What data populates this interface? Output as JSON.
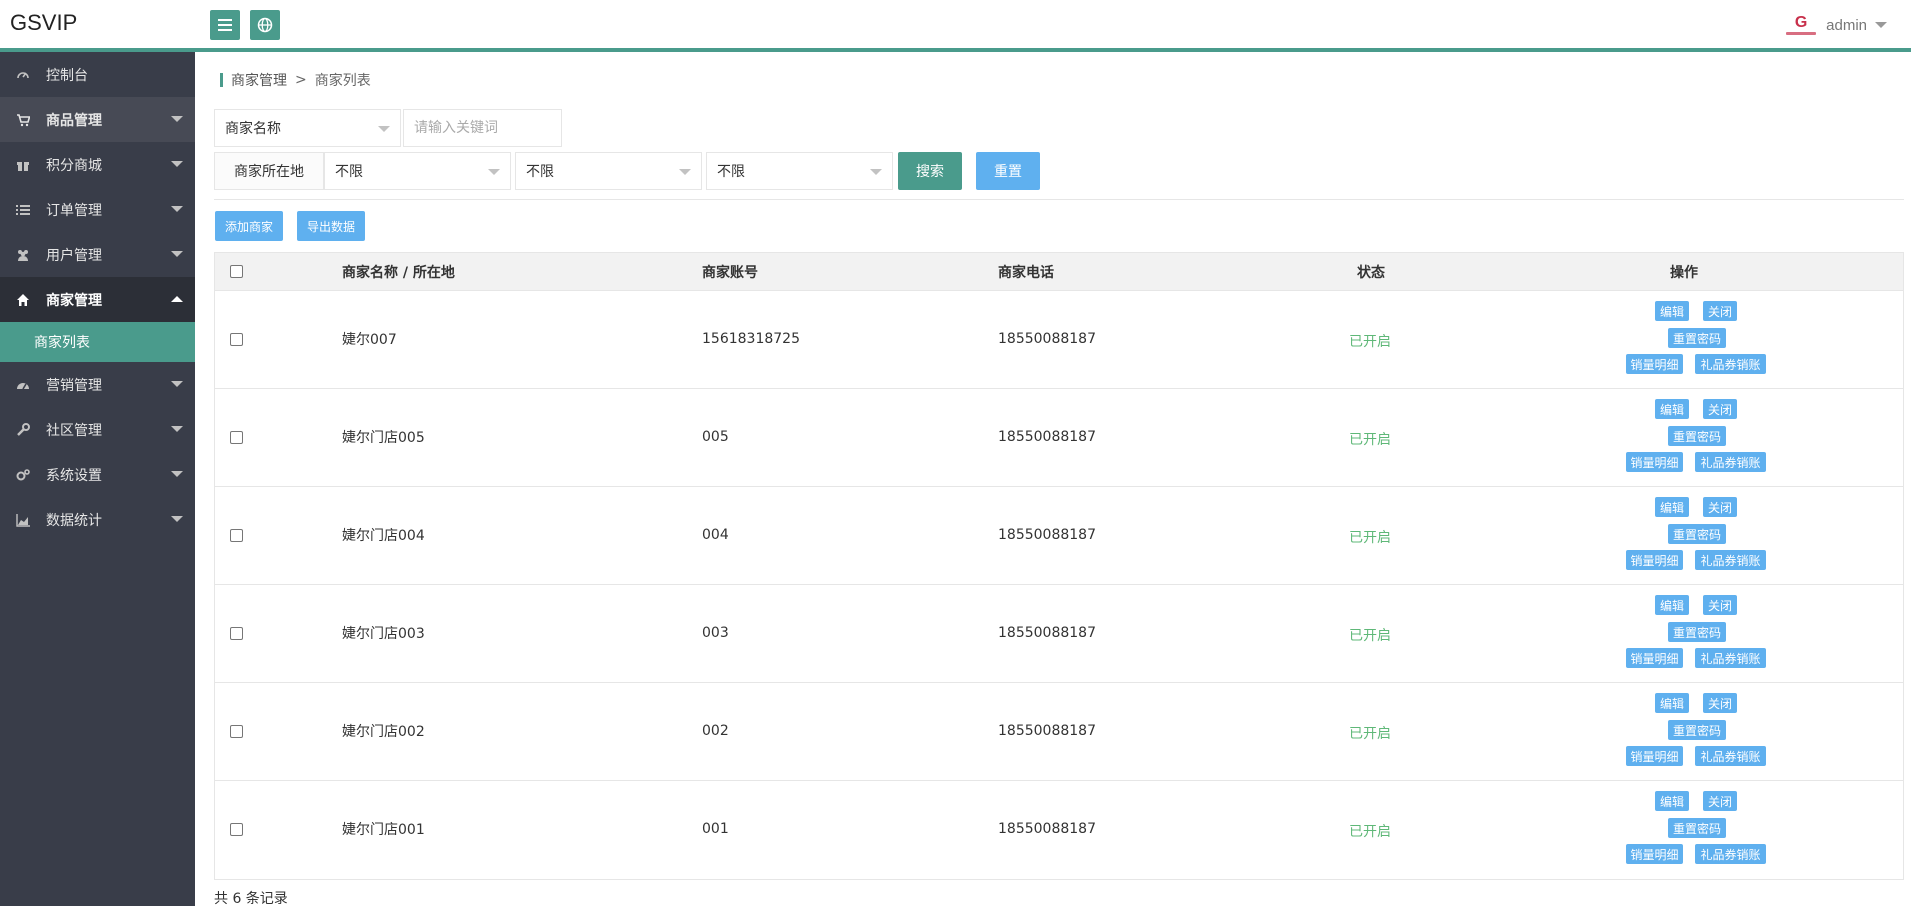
{
  "app": {
    "logo": "GSVIP",
    "user": "admin",
    "avatar_letter": "G"
  },
  "sidebar": {
    "items": [
      {
        "label": "控制台",
        "icon": "dashboard-icon"
      },
      {
        "label": "商品管理",
        "icon": "cart-icon"
      },
      {
        "label": "积分商城",
        "icon": "gift-icon"
      },
      {
        "label": "订单管理",
        "icon": "list-icon"
      },
      {
        "label": "用户管理",
        "icon": "users-icon"
      },
      {
        "label": "商家管理",
        "icon": "home-icon"
      },
      {
        "label": "营销管理",
        "icon": "gauge-icon"
      },
      {
        "label": "社区管理",
        "icon": "wrench-icon"
      },
      {
        "label": "系统设置",
        "icon": "gears-icon"
      },
      {
        "label": "数据统计",
        "icon": "area-chart-icon"
      }
    ],
    "sub_active": "商家列表"
  },
  "breadcrumb": {
    "parent": "商家管理",
    "sep": ">",
    "current": "商家列表"
  },
  "filters": {
    "field_select": "商家名称",
    "keyword_placeholder": "请输入关键词",
    "location_label": "商家所在地",
    "province": "不限",
    "city": "不限",
    "district": "不限",
    "search_label": "搜索",
    "reset_label": "重置"
  },
  "actions": {
    "add_label": "添加商家",
    "export_label": "导出数据"
  },
  "table": {
    "headers": {
      "name": "商家名称 / 所在地",
      "account": "商家账号",
      "phone": "商家电话",
      "status": "状态",
      "ops": "操作"
    },
    "rows": [
      {
        "name": "婕尔007",
        "account": "15618318725",
        "phone": "18550088187",
        "status": "已开启"
      },
      {
        "name": "婕尔门店005",
        "account": "005",
        "phone": "18550088187",
        "status": "已开启"
      },
      {
        "name": "婕尔门店004",
        "account": "004",
        "phone": "18550088187",
        "status": "已开启"
      },
      {
        "name": "婕尔门店003",
        "account": "003",
        "phone": "18550088187",
        "status": "已开启"
      },
      {
        "name": "婕尔门店002",
        "account": "002",
        "phone": "18550088187",
        "status": "已开启"
      },
      {
        "name": "婕尔门店001",
        "account": "001",
        "phone": "18550088187",
        "status": "已开启"
      }
    ],
    "op_labels": {
      "edit": "编辑",
      "close": "关闭",
      "reset_pwd": "重置密码",
      "sales": "销量明细",
      "gift": "礼品券销账"
    }
  },
  "footer": {
    "count_text": "共 6 条记录"
  },
  "colors": {
    "accent": "#4a9b8c",
    "blue": "#5fb0ef",
    "sidebar": "#393d49",
    "status_on": "#5fb878"
  }
}
